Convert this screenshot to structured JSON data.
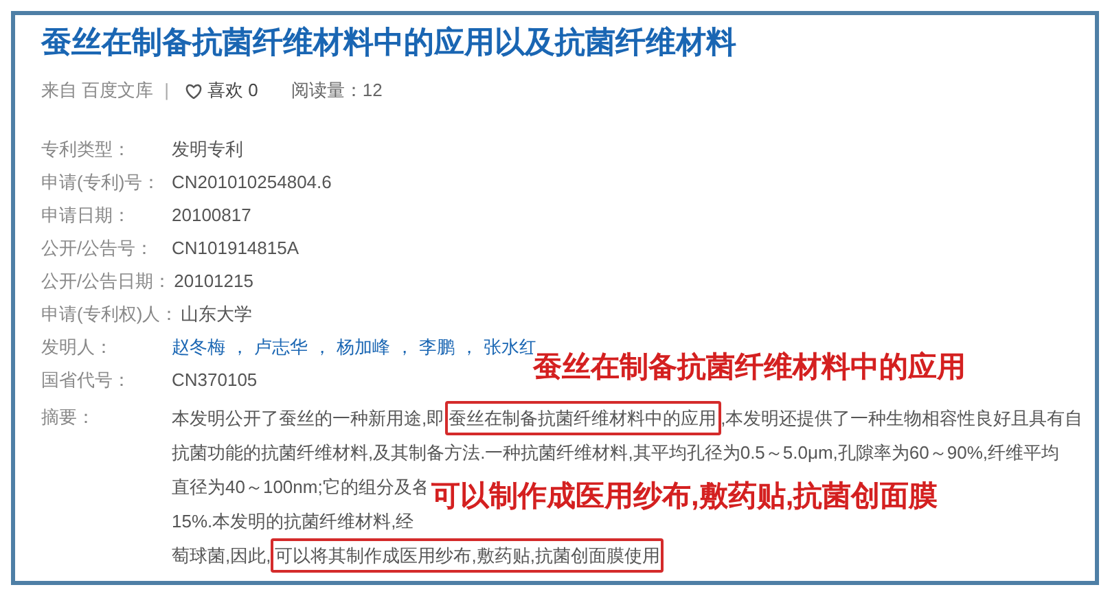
{
  "title": "蚕丝在制备抗菌纤维材料中的应用以及抗菌纤维材料",
  "meta": {
    "source": "来自 百度文库",
    "separator": "|",
    "likes": "喜欢 0",
    "reads": "阅读量：12"
  },
  "fields": [
    {
      "label": "专利类型：",
      "value": "发明专利"
    },
    {
      "label": "申请(专利)号：",
      "value": "CN201010254804.6"
    },
    {
      "label": "申请日期：",
      "value": "20100817"
    },
    {
      "label": "公开/公告号：",
      "value": "CN101914815A"
    },
    {
      "label": "公开/公告日期：",
      "value": "20101215"
    },
    {
      "label": "申请(专利权)人：",
      "value": "山东大学"
    }
  ],
  "inventors": {
    "label": "发明人：",
    "names": [
      "赵冬梅",
      "卢志华",
      "杨加峰",
      "李鹏",
      "张水红"
    ],
    "separator": "，"
  },
  "code": {
    "label": "国省代号：",
    "value": "CN370105"
  },
  "abstract": {
    "label": "摘要：",
    "lines": [
      [
        {
          "text": "本发明公开了蚕丝的一种新用途,即",
          "boxed": false
        },
        {
          "text": "蚕丝在制备抗菌纤维材料中的应用",
          "boxed": true
        },
        {
          "text": ",本发明还提供了一种生物相容性良好且具有自",
          "boxed": false
        }
      ],
      [
        {
          "text": "抗菌功能的抗菌纤维材料,及其制备方法.一种抗菌纤维材料,其平均孔径为0.5～5.0μm,孔隙率为60～90%,纤维平均",
          "boxed": false
        }
      ],
      [
        {
          "text": "直径为40～100nm;它的组分及各",
          "boxed": false
        }
      ],
      [
        {
          "text": "15%.本发明的抗菌纤维材料,经",
          "boxed": false
        }
      ],
      [
        {
          "text": "萄球菌,因此,",
          "boxed": false
        },
        {
          "text": "可以将其制作成医用纱布,敷药贴,抗菌创面膜使用",
          "boxed": true
        }
      ]
    ]
  },
  "callouts": [
    "蚕丝在制备抗菌纤维材料中的应用",
    "可以制作成医用纱布,敷药贴,抗菌创面膜"
  ]
}
